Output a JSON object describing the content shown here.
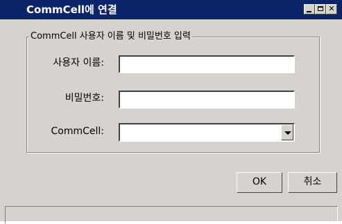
{
  "window": {
    "title": "CommCell에 연결",
    "controls": {
      "minimize": "",
      "maximize": "",
      "close": "✕"
    }
  },
  "group": {
    "legend": "CommCell 사용자 이름 및 비밀번호 입력"
  },
  "form": {
    "username_label": "사용자 이름:",
    "username_value": "",
    "password_label": "비밀번호:",
    "password_value": "",
    "commcell_label": "CommCell:",
    "commcell_selected": ""
  },
  "buttons": {
    "ok": "OK",
    "cancel": "취소"
  },
  "colors": {
    "titlebar": "#0c246a",
    "face": "#d6d3ce"
  }
}
